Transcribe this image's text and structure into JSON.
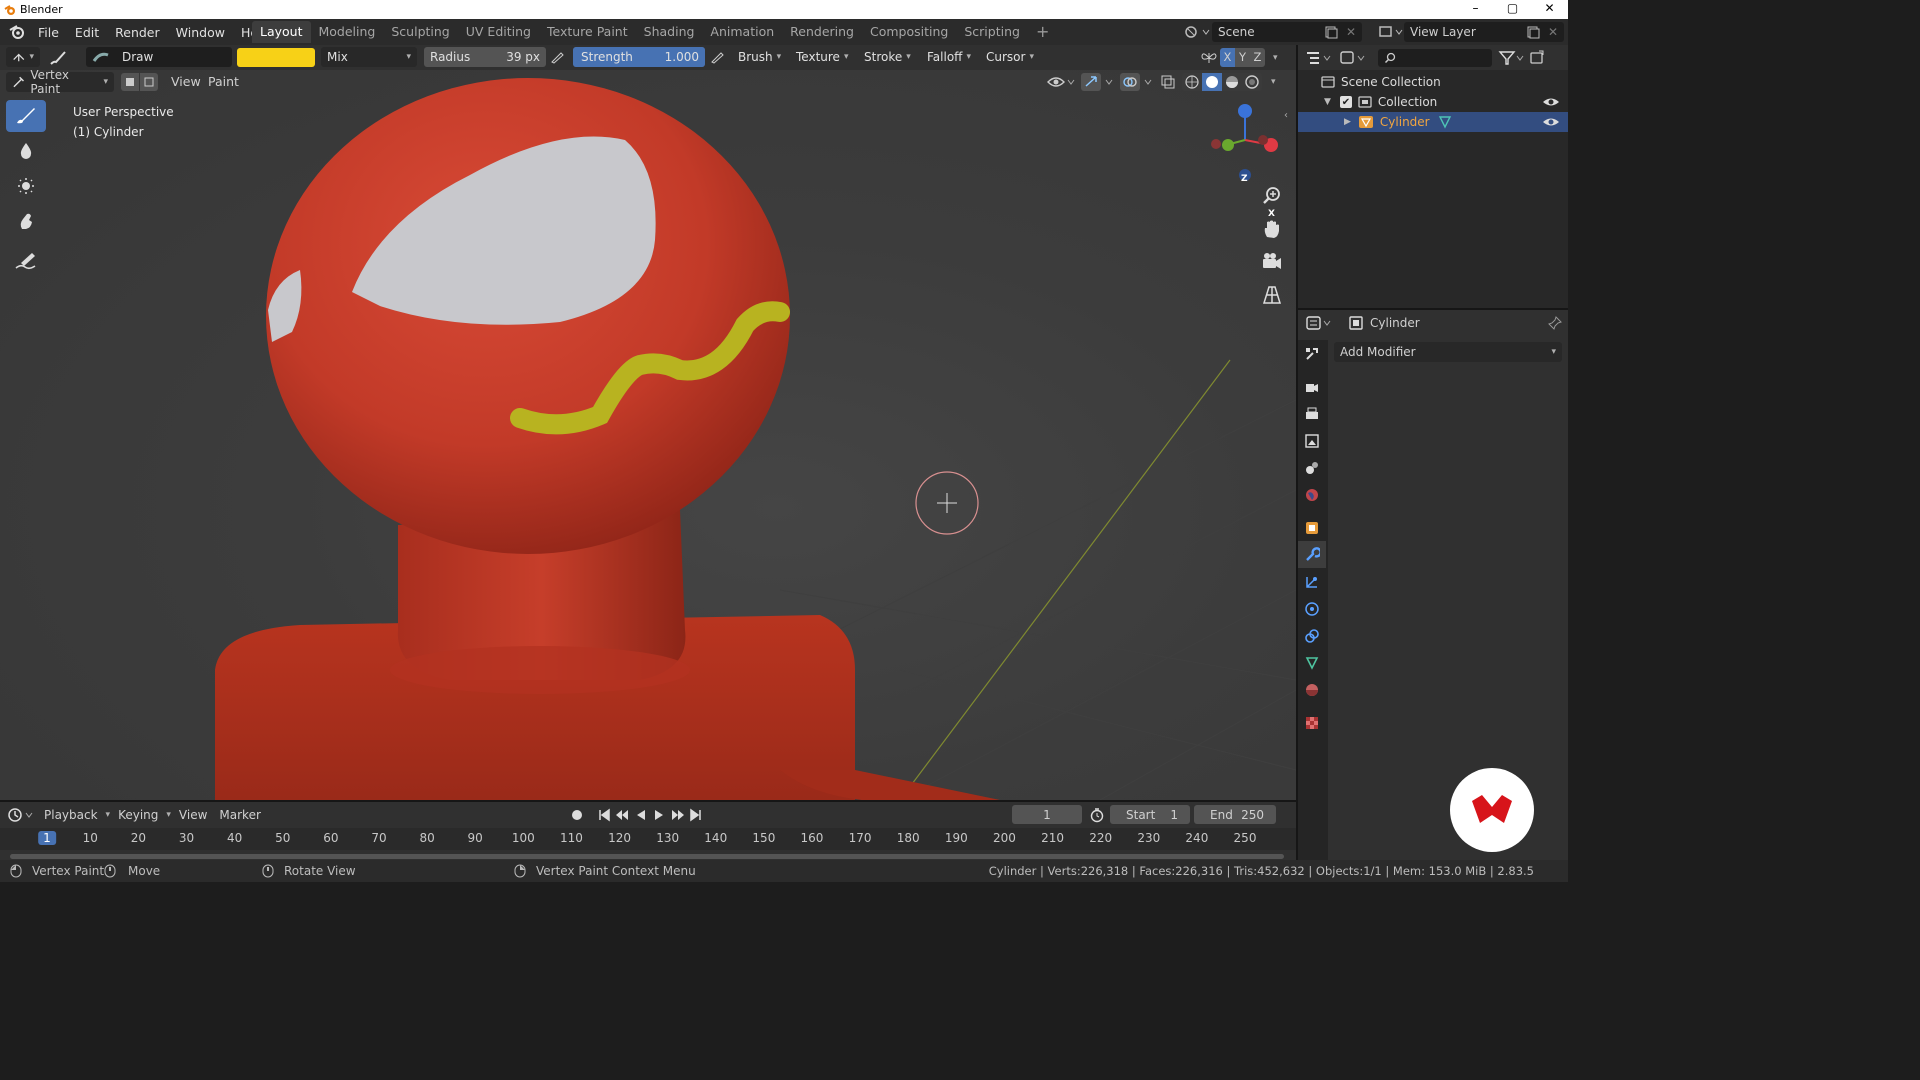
{
  "window": {
    "title": "Blender",
    "controls": [
      "–",
      "▢",
      "✕"
    ]
  },
  "menubar": {
    "items": [
      "File",
      "Edit",
      "Render",
      "Window",
      "Help"
    ]
  },
  "workspaces": {
    "tabs": [
      "Layout",
      "Modeling",
      "Sculpting",
      "UV Editing",
      "Texture Paint",
      "Shading",
      "Animation",
      "Rendering",
      "Compositing",
      "Scripting"
    ],
    "active": "Layout",
    "add": "+"
  },
  "scene": {
    "label": "Scene"
  },
  "view_layer": {
    "label": "View Layer"
  },
  "tool_header": {
    "brush_name": "Draw",
    "color": "#f7d117",
    "blend_mode": "Mix",
    "radius_label": "Radius",
    "radius_value": "39 px",
    "strength_label": "Strength",
    "strength_value": "1.000",
    "strength_fraction": 1.0,
    "menus": [
      "Brush",
      "Texture",
      "Stroke",
      "Falloff",
      "Cursor"
    ],
    "axes": [
      "X",
      "Y",
      "Z"
    ]
  },
  "viewport_header": {
    "mode": "Vertex Paint",
    "menus": [
      "View",
      "Paint"
    ]
  },
  "viewport": {
    "perspective": "User Perspective",
    "object": "(1) Cylinder",
    "object_color": "#c23a28",
    "paint_highlight_color": "#c8c8cc",
    "paint_stroke_color": "#b8b320",
    "gizmo_axes": [
      "Z",
      "X",
      "Y"
    ],
    "axis_colors": {
      "x": "#e03a44",
      "y": "#6aa82e",
      "z": "#3a73d9"
    }
  },
  "outliner": {
    "root": "Scene Collection",
    "collection": "Collection",
    "object": "Cylinder"
  },
  "properties": {
    "object": "Cylinder",
    "add_modifier": "Add Modifier",
    "tabs": [
      "tool",
      "render",
      "output",
      "view-layer",
      "scene",
      "world",
      "object",
      "modifier",
      "particles",
      "physics",
      "constraints",
      "data",
      "material",
      "texture"
    ],
    "active_tab": "modifier"
  },
  "timeline": {
    "menus": [
      "Playback",
      "Keying",
      "View",
      "Marker"
    ],
    "current_frame": "1",
    "start_label": "Start",
    "start_value": "1",
    "end_label": "End",
    "end_value": "250",
    "ruler": [
      "1",
      "10",
      "20",
      "30",
      "40",
      "50",
      "60",
      "70",
      "80",
      "90",
      "100",
      "110",
      "120",
      "130",
      "140",
      "150",
      "160",
      "170",
      "180",
      "190",
      "200",
      "210",
      "220",
      "230",
      "240",
      "250"
    ]
  },
  "statusbar": {
    "mode": "Vertex Paint",
    "move": "Move",
    "rotate": "Rotate View",
    "context": "Vertex Paint Context Menu",
    "stats": "Cylinder | Verts:226,318 | Faces:226,316 | Tris:452,632 | Objects:1/1 | Mem: 153.0 MiB | 2.83.5"
  }
}
